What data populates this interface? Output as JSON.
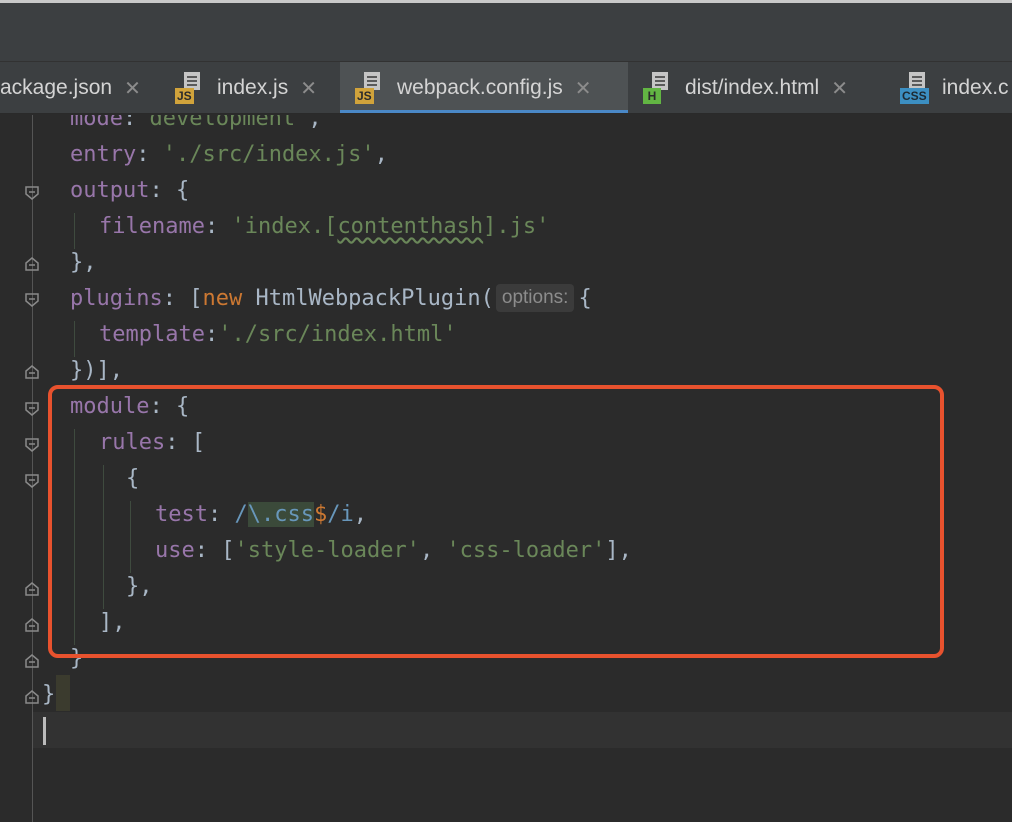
{
  "tabs": [
    {
      "label": "ackage.json",
      "icon": "json-file-icon",
      "active": false
    },
    {
      "label": "index.js",
      "icon": "js-file-icon",
      "icon_text": "JS",
      "active": false
    },
    {
      "label": "webpack.config.js",
      "icon": "js-file-icon",
      "icon_text": "JS",
      "active": true
    },
    {
      "label": "dist/index.html",
      "icon": "html-file-icon",
      "icon_text": "H",
      "active": false
    },
    {
      "label": "index.c",
      "icon": "css-file-icon",
      "icon_text": "CSS",
      "active": false
    }
  ],
  "close_glyph": "✕",
  "editor": {
    "inlay_hint": "options:",
    "lines": {
      "mode_key": "mode",
      "mode_val": "'development'",
      "entry_key": "entry",
      "entry_val": "'./src/index.js'",
      "output_key": "output",
      "filename_key": "filename",
      "filename_val_a": "'index.[",
      "filename_val_b": "contenthash",
      "filename_val_c": "].js'",
      "plugins_key": "plugins",
      "new_kw": "new",
      "plugin_class": "HtmlWebpackPlugin(",
      "template_key": "template",
      "template_val": "'./src/index.html'",
      "module_key": "module",
      "rules_key": "rules",
      "test_key": "test",
      "regex_slash": "/",
      "regex_escape": "\\.css",
      "regex_dollar": "$",
      "regex_end": "/i",
      "use_key": "use",
      "loader1": "'style-loader'",
      "loader2": "'css-loader'"
    }
  },
  "colors": {
    "highlight_box": "#e8522e",
    "active_tab_underline": "#4a88c7"
  }
}
